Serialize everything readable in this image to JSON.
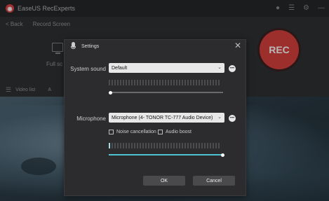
{
  "app": {
    "title": "EaseUS RecExperts",
    "logo_glyph": "◉",
    "back_label": "< Back",
    "record_screen_label": "Record Screen",
    "fullscreen_label": "Full sc",
    "video_list_label": "Video list",
    "a_label": "A",
    "rec_label": "REC",
    "accent_color": "#d9423e"
  },
  "dialog": {
    "title": "Settings",
    "close_glyph": "✕",
    "system_sound": {
      "label": "System sound",
      "device": "Default",
      "more_glyph": "•••",
      "level": 0,
      "volume": 0.0
    },
    "microphone": {
      "label": "Microphone",
      "device": "Microphone (4- TONOR TC-777 Audio Device)",
      "more_glyph": "•••",
      "noise_cancellation_label": "Noise cancellation",
      "noise_cancellation_checked": false,
      "audio_boost_label": "Audio boost",
      "audio_boost_checked": false,
      "level": 1,
      "volume": 1.0
    },
    "ok_label": "OK",
    "cancel_label": "Cancel",
    "accent_color": "#4fc3d0"
  }
}
